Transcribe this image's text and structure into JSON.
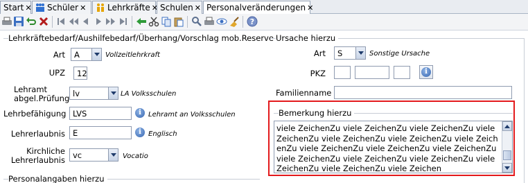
{
  "tabs": [
    {
      "label": "Start",
      "close": "✕"
    },
    {
      "label": "Schüler",
      "close": "✕"
    },
    {
      "label": "Lehrkräfte",
      "close": "✕"
    },
    {
      "label": "Schulen",
      "close": "✕"
    },
    {
      "label": "Personalveränderungen",
      "close": "✕"
    }
  ],
  "toolbar_icons": [
    "print-icon",
    "save-icon",
    "undo-icon",
    "delete-icon",
    "first-icon",
    "previous-page-icon",
    "previous-icon",
    "next-icon",
    "next-page-icon",
    "last-icon",
    "back-arrow-icon",
    "cut-icon",
    "copy-icon",
    "paste-icon",
    "search-icon",
    "print-preview-icon",
    "view-icon",
    "clear-icon",
    "help-icon"
  ],
  "left": {
    "section_title": "Lehrkräftebedarf/Aushilfebedarf/Überhang/Vorschlag mob.Reserve",
    "art": {
      "label": "Art",
      "value": "A",
      "hint": "Vollzeitlehrkraft"
    },
    "upz": {
      "label": "UPZ",
      "value": "12"
    },
    "lehramt": {
      "label_line1": "Lehramt",
      "label_line2": "abgel.Prüfung",
      "value": "lv",
      "hint": "LA Volksschulen"
    },
    "lehrbefaehigung": {
      "label": "Lehrbefähigung",
      "value": "LVS",
      "hint": "Lehramt an Volksschulen"
    },
    "lehrerlaubnis": {
      "label": "Lehrerlaubnis",
      "value": "E",
      "hint": "Englisch"
    },
    "kirchliche": {
      "label_line1": "Kirchliche",
      "label_line2": "Lehrerlaubnis",
      "value": "vc",
      "hint": "Vocatio"
    },
    "next_section_title": "Personalangaben hierzu"
  },
  "right": {
    "section_title": "Ursache hierzu",
    "art": {
      "label": "Art",
      "value": "S",
      "hint": "Sonstige Ursache"
    },
    "pkz": {
      "label": "PKZ",
      "v1": "",
      "v2": "",
      "v3": ""
    },
    "familienname": {
      "label": "Familienname",
      "value": ""
    },
    "bemerkung": {
      "title": "Bemerkung hierzu",
      "text": "viele ZeichenZu viele ZeichenZu viele ZeichenZu viele ZeichenZu viele ZeichenZu viele ZeichenZu viele ZeichenZu viele ZeichenZu viele ZeichenZu viele ZeichenZu viele ZeichenZu viele ZeichenZu viele ZeichenZu viele ZeichenZu viele ZeichenZu viele Zeichen"
    }
  },
  "colors": {
    "highlight": "#e3191c",
    "accent": "#3766b0"
  }
}
